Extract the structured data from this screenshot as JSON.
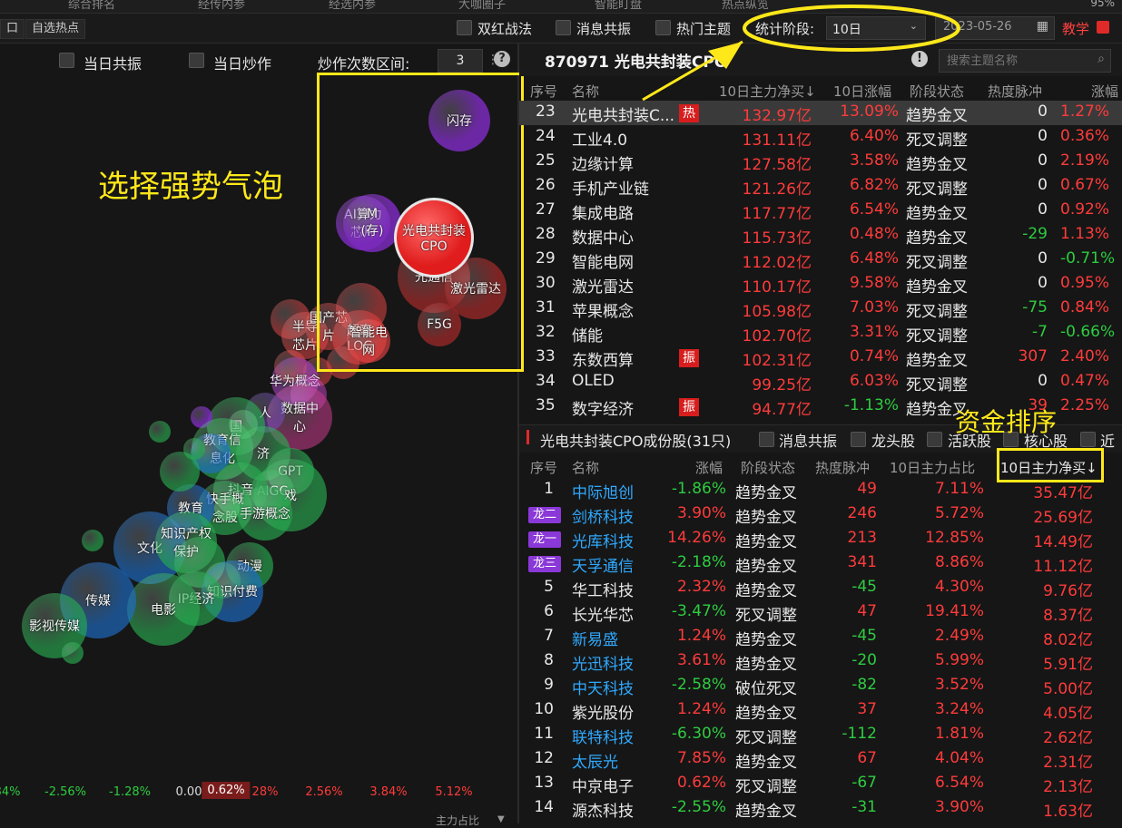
{
  "top_tabs": [
    "综合排名",
    "经传内参",
    "经选内参",
    "大咖圈子",
    "智能盯盘",
    "热点纵览"
  ],
  "top_right_zoom": "95%",
  "toolbar": {
    "left_btn": "口",
    "self_hot_btn": "自选热点",
    "filters": [
      "双红战法",
      "消息共振",
      "热门主题"
    ],
    "stage_label": "统计阶段:",
    "stage_value": "10日",
    "date": "2023-05-26",
    "teach_btn": "教学"
  },
  "bubble_controls": {
    "same_day_resonance": "当日共振",
    "same_day_speculation": "当日炒作",
    "spec_range_label": "炒作次数区间:",
    "spec_range_value": "3",
    "help": "?"
  },
  "axis_ticks": [
    "84%",
    "-2.56%",
    "-1.28%",
    "0.00",
    "0.62%",
    "28%",
    "2.56%",
    "3.84%",
    "5.12%"
  ],
  "axis_title": "主力占比",
  "bubble_labels": [
    {
      "text": "闪存"
    },
    {
      "text": "AI算力\n芯片"
    },
    {
      "text": "M\n(存)"
    },
    {
      "text": "光电共封装\nCPO"
    },
    {
      "text": "光通信"
    },
    {
      "text": "激光雷达"
    },
    {
      "text": "F5G"
    },
    {
      "text": "半导\n芯片"
    },
    {
      "text": "国产芯\n片"
    },
    {
      "text": "超毫\nLOC"
    },
    {
      "text": "智能电\n网"
    },
    {
      "text": "华为概念"
    },
    {
      "text": "人"
    },
    {
      "text": "数据中\n心"
    },
    {
      "text": "国"
    },
    {
      "text": "教育信\n息化"
    },
    {
      "text": "济"
    },
    {
      "text": "GPT"
    },
    {
      "text": "AIGC"
    },
    {
      "text": "戏"
    },
    {
      "text": "抖音"
    },
    {
      "text": "快手概\n念股"
    },
    {
      "text": "手游概念"
    },
    {
      "text": "教育"
    },
    {
      "text": "文化"
    },
    {
      "text": "知识产权\n保护"
    },
    {
      "text": "动漫"
    },
    {
      "text": "知识付费"
    },
    {
      "text": "IP经济"
    },
    {
      "text": "电影"
    },
    {
      "text": "传媒"
    },
    {
      "text": "影视传媒"
    }
  ],
  "theme": {
    "code_title": "870971 光电共封装CPO",
    "search_placeholder": "搜索主题名称",
    "headers": [
      "序号",
      "名称",
      "10日主力净买↓",
      "10日涨幅",
      "阶段状态",
      "热度脉冲",
      "涨幅"
    ],
    "rows": [
      {
        "no": "23",
        "name": "光电共封装C...",
        "tag": "热",
        "net": "132.97亿",
        "chg": "13.09%",
        "state": "趋势金叉",
        "heat": "0",
        "chg2": "1.27%",
        "sel": true
      },
      {
        "no": "24",
        "name": "工业4.0",
        "tag": "",
        "net": "131.11亿",
        "chg": "6.40%",
        "state": "死叉调整",
        "heat": "0",
        "chg2": "0.36%"
      },
      {
        "no": "25",
        "name": "边缘计算",
        "tag": "",
        "net": "127.58亿",
        "chg": "3.58%",
        "state": "趋势金叉",
        "heat": "0",
        "chg2": "2.19%"
      },
      {
        "no": "26",
        "name": "手机产业链",
        "tag": "",
        "net": "121.26亿",
        "chg": "6.82%",
        "state": "死叉调整",
        "heat": "0",
        "chg2": "0.67%"
      },
      {
        "no": "27",
        "name": "集成电路",
        "tag": "",
        "net": "117.77亿",
        "chg": "6.54%",
        "state": "趋势金叉",
        "heat": "0",
        "chg2": "0.92%"
      },
      {
        "no": "28",
        "name": "数据中心",
        "tag": "",
        "net": "115.73亿",
        "chg": "0.48%",
        "state": "趋势金叉",
        "heat": "-29",
        "chg2": "1.13%"
      },
      {
        "no": "29",
        "name": "智能电网",
        "tag": "",
        "net": "112.02亿",
        "chg": "6.48%",
        "state": "死叉调整",
        "heat": "0",
        "chg2": "-0.71%"
      },
      {
        "no": "30",
        "name": "激光雷达",
        "tag": "",
        "net": "110.17亿",
        "chg": "9.58%",
        "state": "趋势金叉",
        "heat": "0",
        "chg2": "0.95%"
      },
      {
        "no": "31",
        "name": "苹果概念",
        "tag": "",
        "net": "105.98亿",
        "chg": "7.03%",
        "state": "死叉调整",
        "heat": "-75",
        "chg2": "0.84%"
      },
      {
        "no": "32",
        "name": "储能",
        "tag": "",
        "net": "102.70亿",
        "chg": "3.31%",
        "state": "死叉调整",
        "heat": "-7",
        "chg2": "-0.66%"
      },
      {
        "no": "33",
        "name": "东数西算",
        "tag": "振",
        "net": "102.31亿",
        "chg": "0.74%",
        "state": "趋势金叉",
        "heat": "307",
        "chg2": "2.40%"
      },
      {
        "no": "34",
        "name": "OLED",
        "tag": "",
        "net": "99.25亿",
        "chg": "6.03%",
        "state": "死叉调整",
        "heat": "0",
        "chg2": "0.47%"
      },
      {
        "no": "35",
        "name": "数字经济",
        "tag": "振",
        "net": "94.77亿",
        "chg": "-1.13%",
        "state": "趋势金叉",
        "heat": "39",
        "chg2": "2.25%"
      }
    ]
  },
  "stocks": {
    "title": "光电共封装CPO成份股(31只)",
    "filters": [
      "消息共振",
      "龙头股",
      "活跃股",
      "核心股",
      "近"
    ],
    "headers": [
      "序号",
      "名称",
      "涨幅",
      "阶段状态",
      "热度脉冲",
      "10日主力占比",
      "10日主力净买↓"
    ],
    "rows": [
      {
        "no": "1",
        "tag": "",
        "name": "中际旭创",
        "chg": "-1.86%",
        "state": "趋势金叉",
        "heat": "49",
        "ratio": "7.11%",
        "net": "35.47亿"
      },
      {
        "no": "",
        "tag": "龙二",
        "name": "剑桥科技",
        "chg": "3.90%",
        "state": "趋势金叉",
        "heat": "246",
        "ratio": "5.72%",
        "net": "25.69亿"
      },
      {
        "no": "",
        "tag": "龙一",
        "name": "光库科技",
        "chg": "14.26%",
        "state": "趋势金叉",
        "heat": "213",
        "ratio": "12.85%",
        "net": "14.49亿"
      },
      {
        "no": "",
        "tag": "龙三",
        "name": "天孚通信",
        "chg": "-2.18%",
        "state": "趋势金叉",
        "heat": "341",
        "ratio": "8.86%",
        "net": "11.12亿"
      },
      {
        "no": "5",
        "tag": "",
        "name": "华工科技",
        "chg": "2.32%",
        "state": "趋势金叉",
        "heat": "-45",
        "ratio": "4.30%",
        "net": "9.76亿"
      },
      {
        "no": "6",
        "tag": "",
        "name": "长光华芯",
        "chg": "-3.47%",
        "state": "死叉调整",
        "heat": "47",
        "ratio": "19.41%",
        "net": "8.37亿"
      },
      {
        "no": "7",
        "tag": "",
        "name": "新易盛",
        "chg": "1.24%",
        "state": "趋势金叉",
        "heat": "-45",
        "ratio": "2.49%",
        "net": "8.02亿"
      },
      {
        "no": "8",
        "tag": "",
        "name": "光迅科技",
        "chg": "3.61%",
        "state": "趋势金叉",
        "heat": "-20",
        "ratio": "5.99%",
        "net": "5.91亿"
      },
      {
        "no": "9",
        "tag": "",
        "name": "中天科技",
        "chg": "-2.58%",
        "state": "破位死叉",
        "heat": "-82",
        "ratio": "3.52%",
        "net": "5.00亿"
      },
      {
        "no": "10",
        "tag": "",
        "name": "紫光股份",
        "chg": "1.24%",
        "state": "趋势金叉",
        "heat": "37",
        "ratio": "3.24%",
        "net": "4.05亿"
      },
      {
        "no": "11",
        "tag": "",
        "name": "联特科技",
        "chg": "-6.30%",
        "state": "死叉调整",
        "heat": "-112",
        "ratio": "1.81%",
        "net": "2.62亿"
      },
      {
        "no": "12",
        "tag": "",
        "name": "太辰光",
        "chg": "7.85%",
        "state": "趋势金叉",
        "heat": "67",
        "ratio": "4.04%",
        "net": "2.31亿"
      },
      {
        "no": "13",
        "tag": "",
        "name": "中京电子",
        "chg": "0.62%",
        "state": "死叉调整",
        "heat": "-67",
        "ratio": "6.54%",
        "net": "2.13亿"
      },
      {
        "no": "14",
        "tag": "",
        "name": "源杰科技",
        "chg": "-2.55%",
        "state": "趋势金叉",
        "heat": "-31",
        "ratio": "3.90%",
        "net": "1.63亿"
      }
    ]
  },
  "annotations": {
    "select_strong": "选择强势气泡",
    "fund_sort": "资金排序"
  }
}
